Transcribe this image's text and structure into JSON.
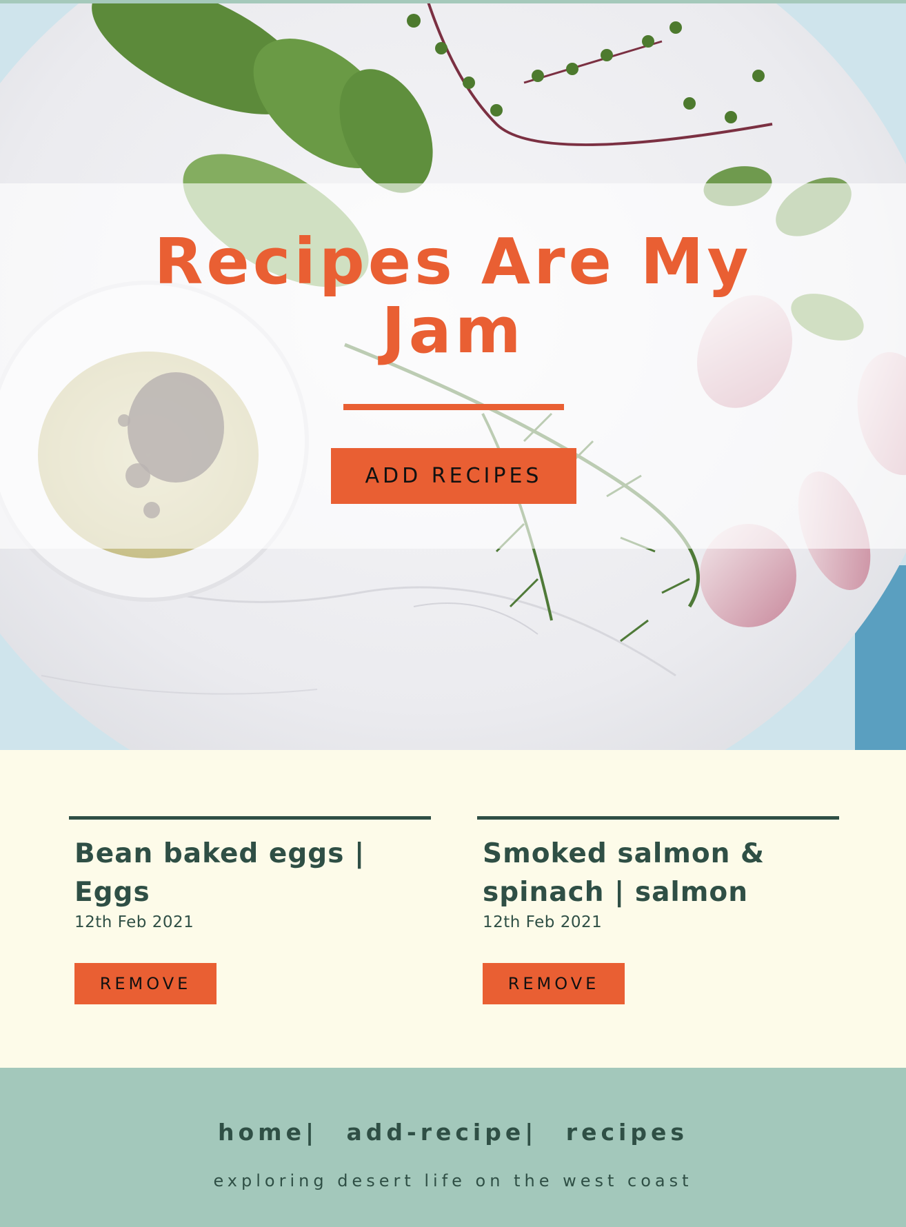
{
  "hero": {
    "title": "Recipes Are My Jam",
    "add_button_label": "ADD RECIPES"
  },
  "recipes": [
    {
      "title": "Bean baked eggs | Eggs",
      "date": "12th Feb 2021",
      "remove_label": "REMOVE"
    },
    {
      "title": "Smoked salmon & spinach | salmon",
      "date": "12th Feb 2021",
      "remove_label": "REMOVE"
    }
  ],
  "footer": {
    "nav": [
      {
        "label": "home|"
      },
      {
        "label": "add-recipe|"
      },
      {
        "label": "recipes"
      }
    ],
    "tagline": "exploring desert life on the west coast"
  },
  "colors": {
    "accent": "#e95f33",
    "dark_green": "#2f4f45",
    "cream": "#fdfbe9",
    "footer_bg": "#a3c8bb"
  }
}
